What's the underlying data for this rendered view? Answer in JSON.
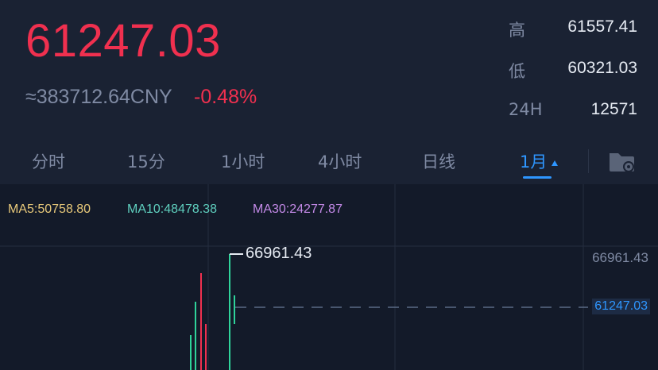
{
  "ticker": {
    "price": "61247.03",
    "cny_value": "≈383712.64CNY",
    "change_pct": "-0.48%"
  },
  "stats": [
    {
      "label": "高",
      "value": "61557.41"
    },
    {
      "label": "低",
      "value": "60321.03"
    },
    {
      "label": "24H",
      "value": "12571"
    }
  ],
  "tabs": [
    {
      "label": "分时"
    },
    {
      "label": "15分"
    },
    {
      "label": "1小时"
    },
    {
      "label": "4小时"
    },
    {
      "label": "日线"
    },
    {
      "label": "1月",
      "active": true
    }
  ],
  "chart": {
    "ma5": "MA5:50758.80",
    "ma10": "MA10:48478.38",
    "ma30": "MA30:24277.87",
    "high_axis": "66961.43",
    "current_axis": "61247.03",
    "peak_label": "66961.43"
  },
  "colors": {
    "up": "#2fd39a",
    "down": "#f0304f",
    "accent": "#2e96ff"
  },
  "icons": {
    "settings": "settings-folder-icon"
  }
}
